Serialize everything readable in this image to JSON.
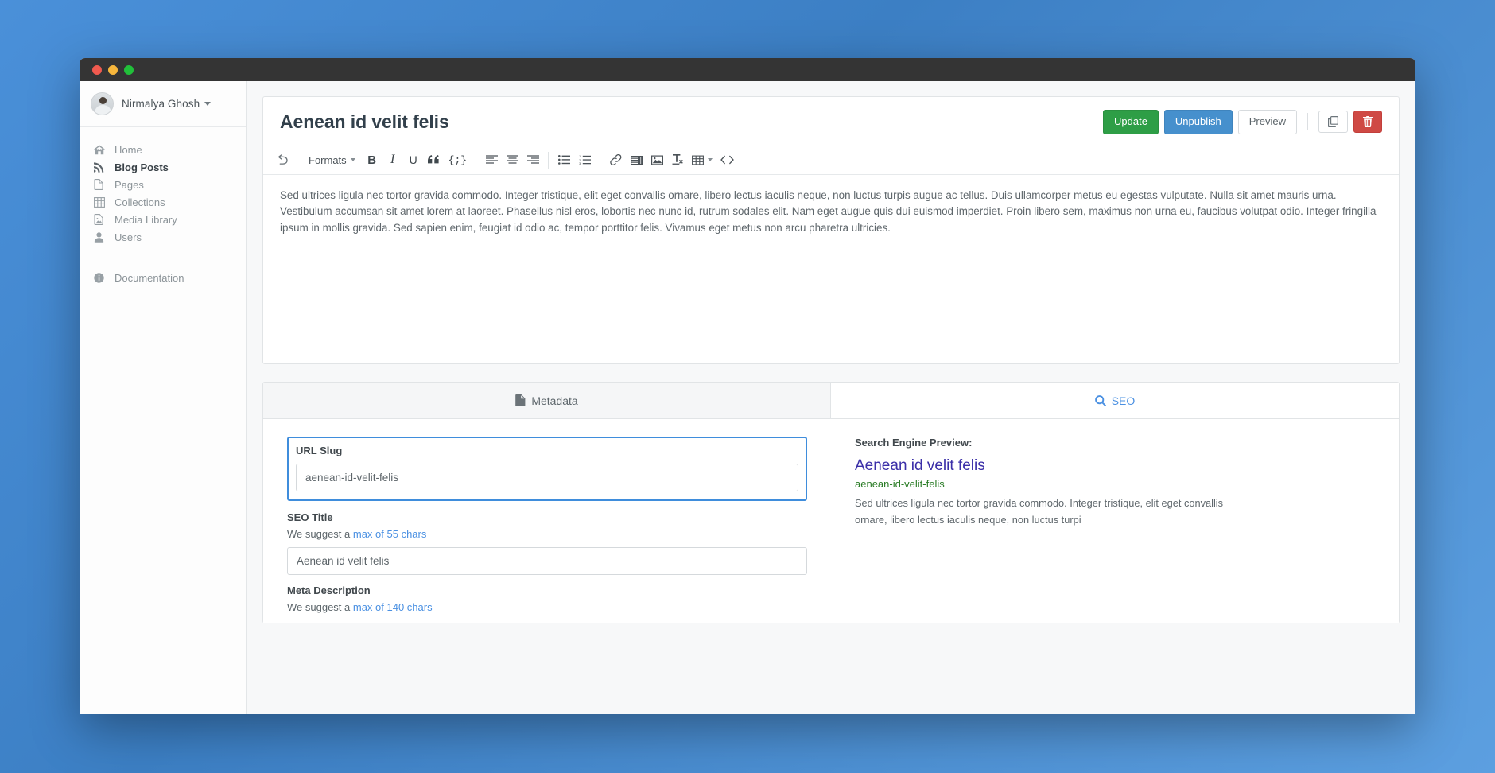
{
  "window": {
    "traffic_lights": [
      "close",
      "minimize",
      "maximize"
    ]
  },
  "sidebar": {
    "user": {
      "name": "Nirmalya Ghosh",
      "avatar_icon": "user-avatar",
      "caret_icon": "caret-down-icon"
    },
    "items": [
      {
        "label": "Home",
        "icon": "home-icon",
        "active": false
      },
      {
        "label": "Blog Posts",
        "icon": "rss-icon",
        "active": true
      },
      {
        "label": "Pages",
        "icon": "file-icon",
        "active": false
      },
      {
        "label": "Collections",
        "icon": "table-icon",
        "active": false
      },
      {
        "label": "Media Library",
        "icon": "image-icon",
        "active": false
      },
      {
        "label": "Users",
        "icon": "user-icon",
        "active": false
      }
    ],
    "documentation": {
      "label": "Documentation",
      "icon": "info-circle-icon"
    }
  },
  "editor": {
    "post_title": "Aenean id velit felis",
    "actions": {
      "update": "Update",
      "unpublish": "Unpublish",
      "preview": "Preview",
      "duplicate_icon": "copy-icon",
      "delete_icon": "trash-icon"
    },
    "toolbar": {
      "undo_icon": "undo-icon",
      "formats_label": "Formats",
      "bold": "B",
      "italic": "I",
      "underline": "U",
      "blockquote_icon": "quote-icon",
      "code_label": "{;}",
      "align_left_icon": "align-left-icon",
      "align_center_icon": "align-center-icon",
      "align_right_icon": "align-right-icon",
      "bullet_list_icon": "bullet-list-icon",
      "numbered_list_icon": "numbered-list-icon",
      "link_icon": "link-icon",
      "media_icon": "media-icon",
      "image_icon": "image-icon",
      "clear_format_icon": "clear-formatting-icon",
      "table_icon": "table-icon",
      "source_code_icon": "source-code-icon"
    },
    "content": "Sed ultrices ligula nec tortor gravida commodo. Integer tristique, elit eget convallis ornare, libero lectus iaculis neque, non luctus turpis augue ac tellus. Duis ullamcorper metus eu egestas vulputate. Nulla sit amet mauris urna. Vestibulum accumsan sit amet lorem at laoreet. Phasellus nisl eros, lobortis nec nunc id, rutrum sodales elit. Nam eget augue quis dui euismod imperdiet. Proin libero sem, maximus non urna eu, faucibus volutpat odio. Integer fringilla ipsum in mollis gravida. Sed sapien enim, feugiat id odio ac, tempor porttitor felis. Vivamus eget metus non arcu pharetra ultricies."
  },
  "tabs": {
    "metadata": {
      "label": "Metadata",
      "icon": "file-icon",
      "active": false
    },
    "seo": {
      "label": "SEO",
      "icon": "search-icon",
      "active": true
    }
  },
  "metadata_form": {
    "url_slug": {
      "label": "URL Slug",
      "value": "aenean-id-velit-felis",
      "placeholder": "URL Slug"
    },
    "seo_title": {
      "label": "SEO Title",
      "hint_prefix": "We suggest a ",
      "hint_link": "max of 55 chars",
      "value": "Aenean id velit felis",
      "placeholder": "SEO Title"
    },
    "meta_description": {
      "label": "Meta Description",
      "hint_prefix": "We suggest a ",
      "hint_link": "max of 140 chars"
    }
  },
  "seo_preview": {
    "heading": "Search Engine Preview:",
    "title": "Aenean id velit felis",
    "url": "aenean-id-velit-felis",
    "description": "Sed ultrices ligula nec tortor gravida commodo. Integer tristique, elit eget convallis ornare, libero lectus iaculis neque, non luctus turpi"
  },
  "colors": {
    "accent_blue": "#4a90e2",
    "update_green": "#2e9e46",
    "unpublish_blue": "#4690cd",
    "delete_red": "#cf4944",
    "serp_title": "#3b2fa8",
    "serp_url": "#2a7c26",
    "desktop_bg": "#4a90d9"
  }
}
